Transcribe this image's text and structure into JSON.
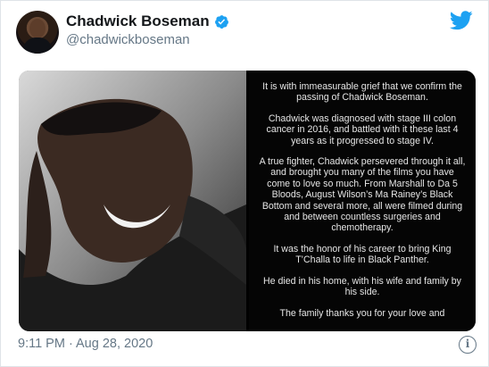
{
  "tweet": {
    "display_name": "Chadwick Boseman",
    "handle": "@chadwickboseman",
    "timestamp": "9:11 PM · Aug 28, 2020",
    "info_icon_glyph": "i",
    "verified_color": "#1da1f2",
    "brand_color": "#1da1f2"
  },
  "statement": {
    "paragraphs": [
      "It is with immeasurable grief that we confirm the passing of Chadwick Boseman.",
      "Chadwick was diagnosed with stage III colon cancer in 2016, and battled with it these last 4 years as it progressed to stage IV.",
      "A true fighter, Chadwick persevered through it all, and brought you many of the films you have come to love so much. From Marshall to Da 5 Bloods, August Wilson’s Ma Rainey’s Black Bottom and several more, all were filmed during and between countless surgeries and chemotherapy.",
      "It was the honor of his career to bring King T’Challa to life in Black Panther.",
      "He died in his home, with his wife and family by his side.",
      "The family thanks you for your love and"
    ]
  },
  "icons": {
    "avatar": "profile-photo",
    "verified": "verified-badge-icon",
    "logo": "twitter-bird-icon",
    "info": "info-icon"
  }
}
